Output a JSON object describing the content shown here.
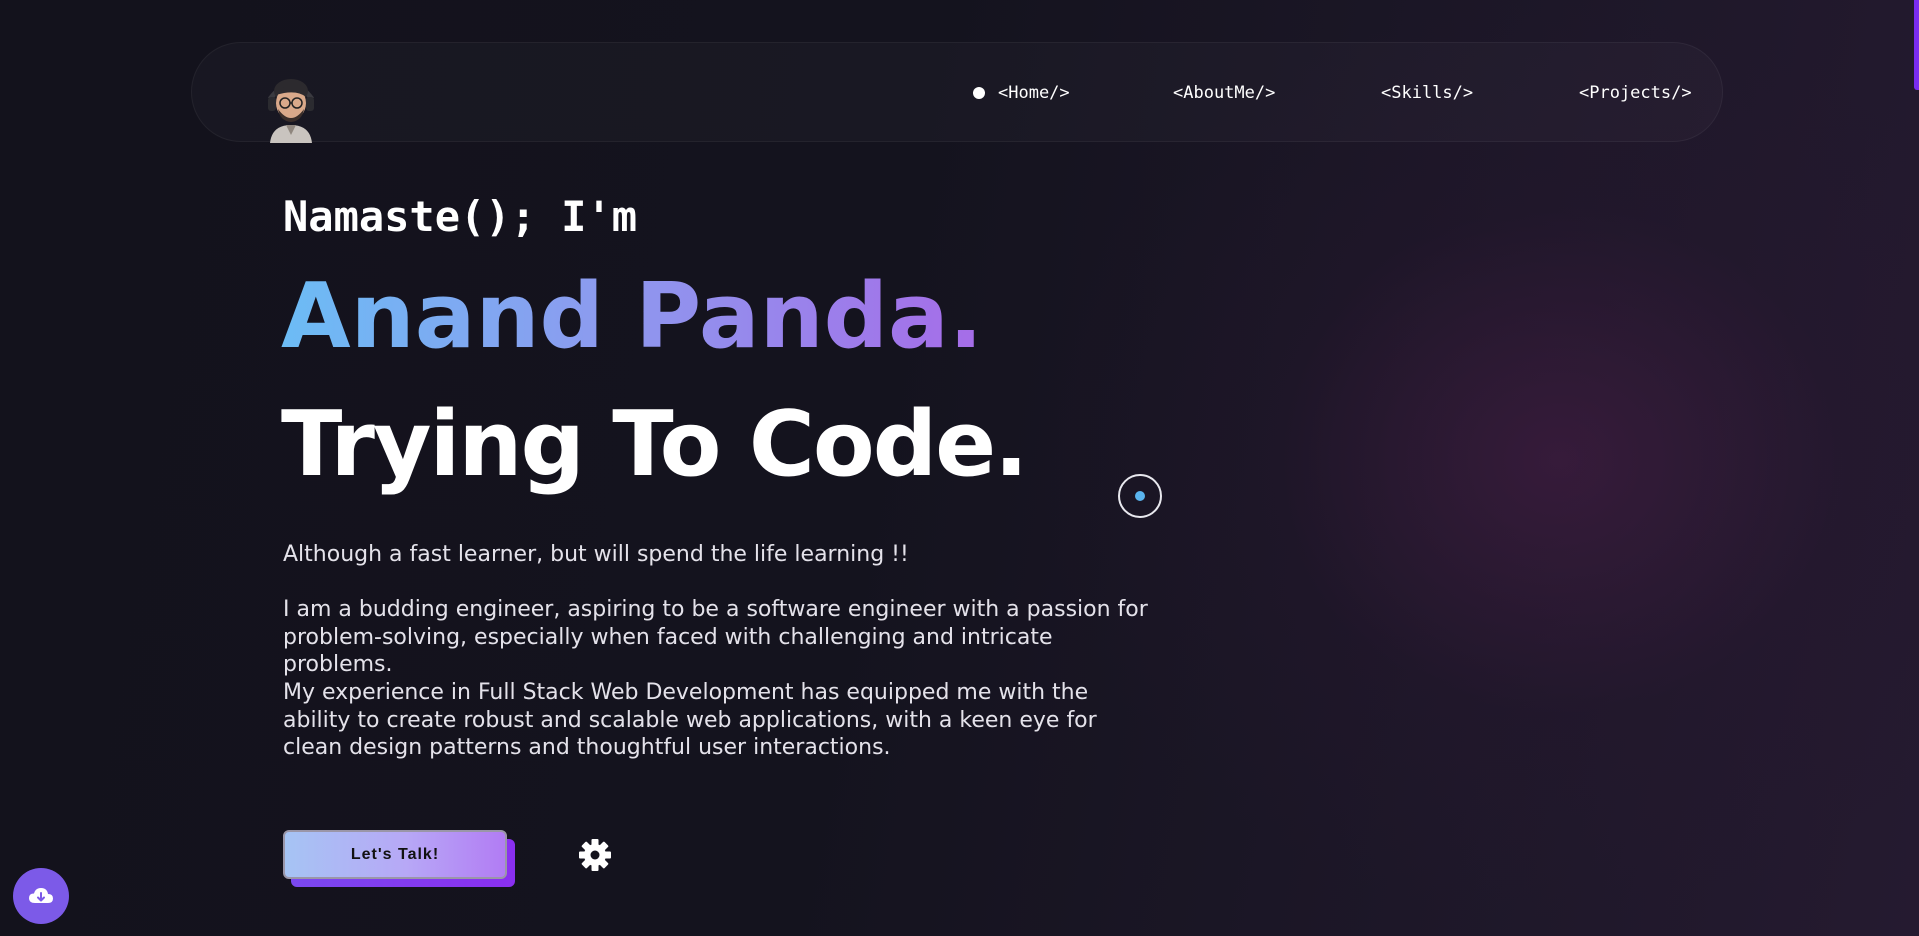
{
  "nav": {
    "avatar_alt": "profile avatar",
    "links": [
      {
        "label": "<Home/>",
        "active": true
      },
      {
        "label": "<AboutMe/>",
        "active": false
      },
      {
        "label": "<Skills/>",
        "active": false
      },
      {
        "label": "<Projects/>",
        "active": false
      }
    ]
  },
  "hero": {
    "greeting": "Namaste(); I'm",
    "name": "Anand Panda.",
    "tagline": "Trying To Code.",
    "paragraphs": [
      "Although a fast learner, but will spend the life learning !!",
      "I am a budding engineer, aspiring to be a software engineer with a passion for problem-solving, especially when faced with challenging and intricate problems.",
      "My experience in Full Stack Web Development has equipped me with the ability to create robust and scalable web applications, with a keen eye for clean design patterns and thoughtful user interactions."
    ],
    "cta_label": "Let's Talk!"
  },
  "icons": {
    "settings": "gear-icon",
    "download": "cloud-download-icon",
    "cursor": "cursor-ring"
  },
  "colors": {
    "background": "#13121c",
    "accent_purple": "#7c5ae8",
    "gradient_start": "#6cbcf5",
    "gradient_end": "#a66ce8",
    "scroll_accent": "#7a2cf0"
  }
}
